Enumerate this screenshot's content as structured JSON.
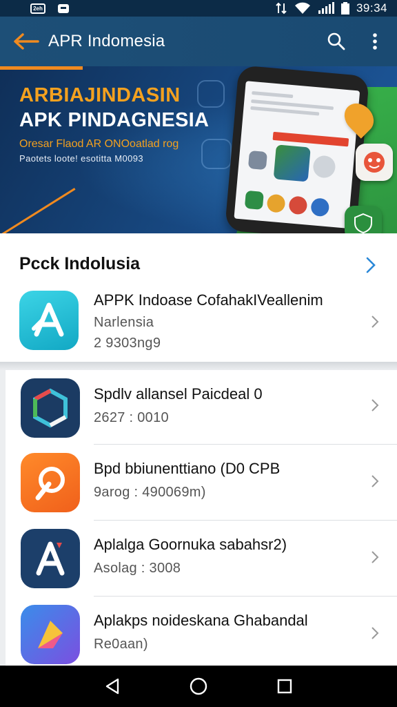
{
  "status_bar": {
    "left_badge": "2eh",
    "time": "39:34",
    "icons": [
      "sim-card-icon",
      "message-icon",
      "data-transfer-icon",
      "wifi-icon",
      "signal-icon",
      "battery-icon"
    ]
  },
  "app_bar": {
    "title": "APR Indomesia",
    "icons": [
      "back-arrow-icon",
      "search-icon",
      "more-vert-icon"
    ]
  },
  "banner": {
    "title_line1": "ARBIAJINDASIN",
    "title_line2": "APK PINDAGNESIA",
    "subtitle_line1": "Oresar Flaod AR ONOoatlad rog",
    "subtitle_line2": "Paotets loote! esotitta M0093"
  },
  "section": {
    "title": "Pcck Indolusia",
    "featured": {
      "name": "APPK Indoase CofahakIVeallenim",
      "category": "Narlensia",
      "meta": "2 9303ng9",
      "icon": "app-store-a-icon"
    }
  },
  "apps": [
    {
      "name": "Spdlv allansel Paicdeal 0",
      "meta": "2627 : 0010",
      "icon": "hexagon-app-icon"
    },
    {
      "name": "Bpd bbiunenttiano (D0 CPB",
      "meta": "9arog : 490069m)",
      "icon": "leaf-app-icon"
    },
    {
      "name": "Aplalga Goornuka sabahsr2)",
      "meta": "Asolag : 3008",
      "icon": "app-store-a-icon"
    },
    {
      "name": "Aplakps noideskana Ghabandal",
      "meta": "Re0aan)",
      "icon": "arrow-app-icon"
    }
  ],
  "nav_bar": {
    "icons": [
      "nav-back-icon",
      "nav-home-icon",
      "nav-recents-icon"
    ]
  },
  "colors": {
    "app_bar": "#1d4f77",
    "accent_orange": "#f08a1f",
    "chevron_blue": "#2a88d8"
  }
}
